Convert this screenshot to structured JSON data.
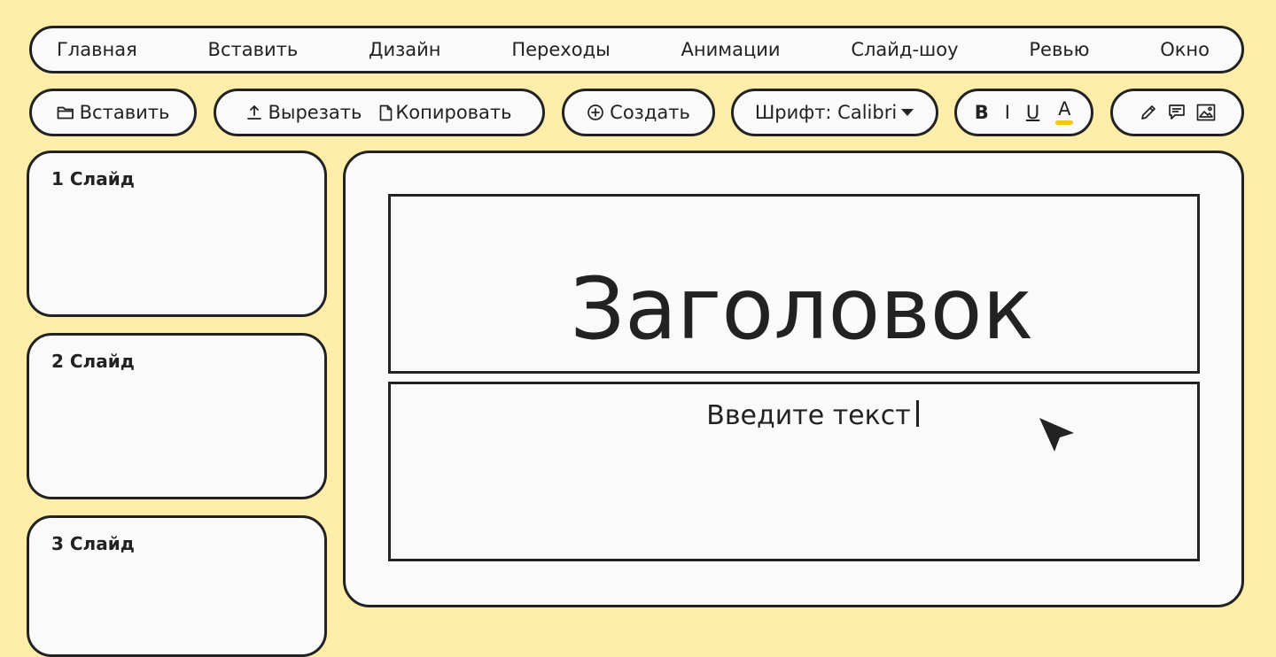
{
  "menu": [
    {
      "label": "Главная"
    },
    {
      "label": "Вставить"
    },
    {
      "label": "Дизайн"
    },
    {
      "label": "Переходы"
    },
    {
      "label": "Анимации"
    },
    {
      "label": "Слайд-шоу"
    },
    {
      "label": "Ревью"
    },
    {
      "label": "Окно"
    }
  ],
  "toolbar": {
    "paste": {
      "label": "Вставить",
      "icon": "folder-icon"
    },
    "cut": {
      "label": "Вырезать",
      "icon": "upload-icon"
    },
    "copy": {
      "label": "Копировать",
      "icon": "document-icon"
    },
    "new": {
      "label": "Создать",
      "icon": "plus-circle-icon"
    },
    "font": {
      "label": "Шрифт: Calibri",
      "icon": "caret-down-icon"
    },
    "format": {
      "bold": "B",
      "italic": "I",
      "underline": "U",
      "color": "A",
      "color_value": "#f5c518"
    },
    "insert_icons": [
      "pencil-icon",
      "comment-icon",
      "image-icon"
    ]
  },
  "slides": [
    {
      "label": "1 Слайд"
    },
    {
      "label": "2 Слайд"
    },
    {
      "label": "3 Слайд"
    }
  ],
  "editor": {
    "title": "Заголовок",
    "body_placeholder": "Введите текст"
  },
  "colors": {
    "background": "#ffeeaa",
    "panel": "#fafafa",
    "stroke": "#222222",
    "accent": "#f5c518"
  }
}
